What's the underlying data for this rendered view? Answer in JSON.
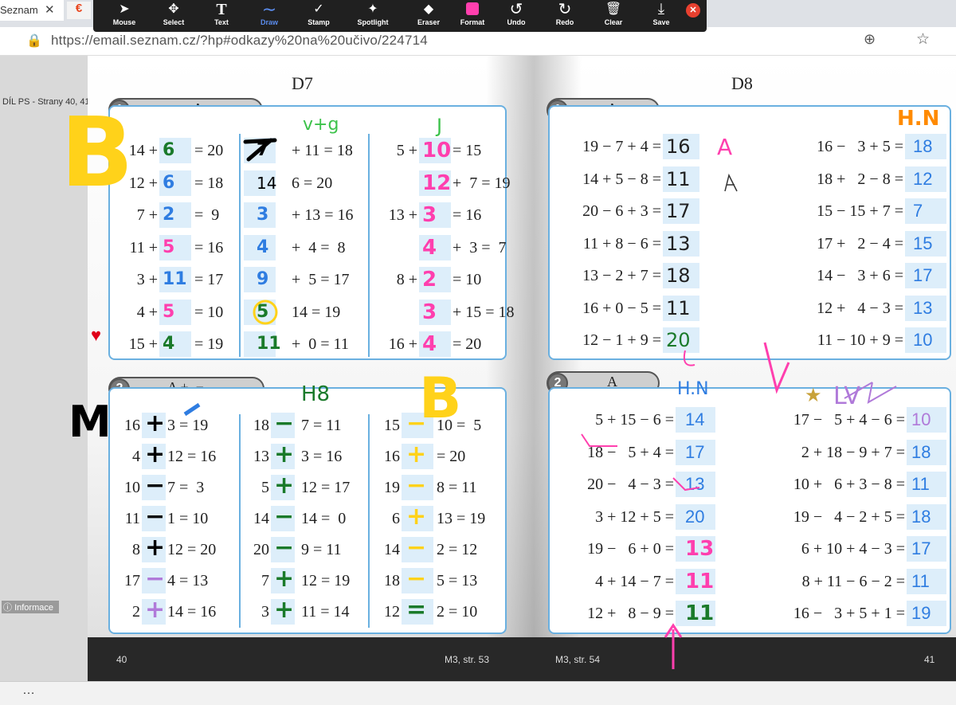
{
  "browser": {
    "tab_title": "Seznam",
    "tab_close": "✕",
    "tab2_icon": "€",
    "url": "https://email.seznam.cz/?hp#odkazy%20na%20učivo/224714"
  },
  "toolbar": {
    "tools": [
      {
        "label": "Mouse",
        "icon": "cursor-icon",
        "glyph": "➤"
      },
      {
        "label": "Select",
        "icon": "move-icon",
        "glyph": "✥"
      },
      {
        "label": "Text",
        "icon": "text-icon",
        "glyph": "T"
      },
      {
        "label": "Draw",
        "icon": "draw-icon",
        "glyph": "∼"
      },
      {
        "label": "Stamp",
        "icon": "stamp-icon",
        "glyph": "✓"
      },
      {
        "label": "Spotlight",
        "icon": "spotlight-icon",
        "glyph": "✦"
      },
      {
        "label": "Eraser",
        "icon": "eraser-icon",
        "glyph": "◆"
      },
      {
        "label": "Format",
        "icon": "format-icon",
        "glyph": ""
      },
      {
        "label": "Undo",
        "icon": "undo-icon",
        "glyph": "↺"
      },
      {
        "label": "Redo",
        "icon": "redo-icon",
        "glyph": "↻"
      },
      {
        "label": "Clear",
        "icon": "trash-icon",
        "glyph": "🗑"
      },
      {
        "label": "Save",
        "icon": "save-icon",
        "glyph": "⤓"
      }
    ],
    "active_tool": "Draw",
    "close_glyph": "✕",
    "format_color": "#ff3fae"
  },
  "sidebar": {
    "title": "DÍL PS - Strany 40, 41",
    "info_label": "Informace",
    "more": "…"
  },
  "footer": {
    "left_page": "40",
    "left_ref": "M3, str. 53",
    "right_ref": "M3, str. 54",
    "right_page": "41"
  },
  "colors": {
    "box_border": "#6ab0e0",
    "answer_blue": "#2f7de1",
    "ink_green": "#1a7a2a",
    "ink_pink": "#ff3fae",
    "ink_yellow": "#ffd21a",
    "ink_orange": "#ff8a00",
    "ink_purple": "#b07ad9"
  },
  "left_page": {
    "heading": "D7",
    "ex1": {
      "number": "1",
      "tail": ", A",
      "col1": [
        "14 +",
        "12 +",
        "7 +",
        "11 +",
        "3 +",
        "4 +",
        "15 +"
      ],
      "col1_end": [
        "= 20",
        "= 18",
        "=  9",
        "= 16",
        "= 17",
        "= 10",
        "= 19"
      ],
      "col1_answers": [
        "6",
        "6",
        "2",
        "5",
        "11",
        "5",
        "4"
      ],
      "col2": [
        "+ 11 = 18",
        "6 = 20",
        "+ 13 = 16",
        "+  4 =  8",
        "+  5 = 17",
        "14 = 19",
        "+  0 = 11"
      ],
      "col2_answers": [
        "7",
        "14",
        "3",
        "4",
        "9",
        "5",
        "11"
      ],
      "col3_a": [
        "5 +",
        "",
        "13 +",
        "",
        "8 +",
        "",
        "16 +"
      ],
      "col3_b": [
        "= 15",
        "+  7 = 19",
        "= 16",
        "+  3 =  7",
        "= 10",
        "+ 15 = 18",
        "= 20"
      ],
      "col3_answers": [
        "10",
        "12",
        "3",
        "4",
        "2",
        "3",
        "4"
      ],
      "note_top": "v+g",
      "note_top2": "J",
      "big_letter": "B"
    },
    "ex2": {
      "number": "2",
      "tail": "A    +, −.",
      "col1_a": [
        "16",
        "4",
        "10",
        "11",
        "8",
        "17",
        "2"
      ],
      "col1_b": [
        "3 = 19",
        "12 = 16",
        "7 =  3",
        "1 = 10",
        "12 = 20",
        "4 = 13",
        "14 = 16"
      ],
      "col1_answers": [
        "+",
        "+",
        "−",
        "−",
        "+",
        "−",
        "+"
      ],
      "col2_a": [
        "18",
        "13",
        "5",
        "14",
        "20",
        "7",
        "3"
      ],
      "col2_b": [
        "7 = 11",
        "3 = 16",
        "12 = 17",
        "14 =  0",
        "9 = 11",
        "12 = 19",
        "11 = 14"
      ],
      "col2_answers": [
        "−",
        "+",
        "+",
        "−",
        "−",
        "+",
        "+"
      ],
      "col3_a": [
        "15",
        "16",
        "19",
        "6",
        "14",
        "18",
        "12"
      ],
      "col3_b": [
        "10 =  5",
        "= 20",
        "8 = 11",
        "13 = 19",
        "2 = 12",
        "5 = 13",
        "2 = 10"
      ],
      "col3_answers": [
        "−",
        "+",
        "−",
        "+",
        "−",
        "−",
        "="
      ],
      "note_top": "H8",
      "big_letter": "M",
      "big_letter2": "B"
    }
  },
  "right_page": {
    "heading": "D8",
    "ex1": {
      "number": "1",
      "tail": "A",
      "left_rows": [
        "19 − 7 + 4 =",
        "14 + 5 − 8 =",
        "20 − 6 + 3 =",
        "11 + 8 − 6 =",
        "13 − 2 + 7 =",
        "16 + 0 − 5 =",
        "12 − 1 + 9 ="
      ],
      "left_answers": [
        "16",
        "11",
        "17",
        "13",
        "18",
        "11",
        "20"
      ],
      "right_rows": [
        "16 −   3 + 5 =",
        "18 +   2 − 8 =",
        "15 − 15 + 7 =",
        "17 +   2 − 4 =",
        "14 −   3 + 6 =",
        "12 +   4 − 3 =",
        "11 − 10 + 9 ="
      ],
      "right_answers": [
        "18",
        "12",
        "7",
        "15",
        "17",
        "13",
        "10"
      ],
      "note_a": "A",
      "note_corner": "H.N"
    },
    "ex2": {
      "number": "2",
      "tail": "A",
      "note_top": "H.N",
      "note_top2": "LV",
      "left_rows": [
        "5 + 15 − 6 =",
        "18 −   5 + 4 =",
        "20 −   4 − 3 =",
        "3 + 12 + 5 =",
        "19 −   6 + 0 =",
        "4 + 14 − 7 =",
        "12 +   8 − 9 ="
      ],
      "left_answers": [
        "14",
        "17",
        "13",
        "20",
        "13",
        "11",
        "11"
      ],
      "right_rows": [
        "17 −   5 + 4 − 6 =",
        "2 + 18 − 9 + 7 =",
        "10 +   6 + 3 − 8 =",
        "19 −   4 − 2 + 5 =",
        "6 + 10 + 4 − 3 =",
        "8 + 11 − 6 − 2 =",
        "16 −   3 + 5 + 1 ="
      ],
      "right_answers": [
        "10",
        "18",
        "11",
        "18",
        "17",
        "11",
        "19"
      ]
    }
  }
}
